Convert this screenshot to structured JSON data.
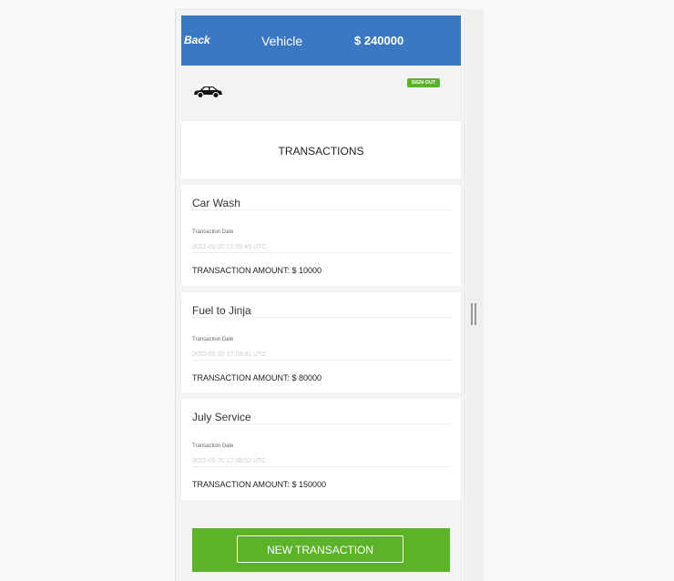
{
  "header": {
    "back_label": "Back",
    "title": "Vehicle",
    "balance": "$ 240000"
  },
  "signout_label": "SIGN OUT",
  "transactions_heading": "TRANSACTIONS",
  "transactions": [
    {
      "title": "Car Wash",
      "date_label": "Transaction Date",
      "date": "2023-02-20 17:09:49 UTC",
      "amount_text": "TRANSACTION AMOUNT: $ 10000"
    },
    {
      "title": "Fuel to Jinja",
      "date_label": "Transaction Date",
      "date": "2023-02-20 17:09:31 UTC",
      "amount_text": "TRANSACTION AMOUNT: $ 80000"
    },
    {
      "title": "July Service",
      "date_label": "Transaction Date",
      "date": "2023-02-20 17:08:52 UTC",
      "amount_text": "TRANSACTION AMOUNT: $ 150000"
    }
  ],
  "new_transaction_label": "NEW TRANSACTION",
  "icons": {
    "car": "car-icon",
    "resize": "resize-handle-icon"
  },
  "colors": {
    "header_blue": "#3a78c3",
    "accent_green": "#5cb32a",
    "background": "#f3f3f4"
  }
}
